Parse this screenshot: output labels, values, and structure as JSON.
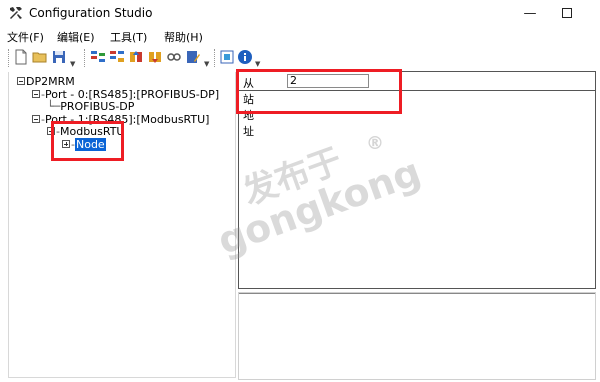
{
  "window": {
    "title": "Configuration Studio",
    "icon": "tools-icon",
    "minimize_glyph": "—"
  },
  "menubar": {
    "items": [
      "文件(F)",
      "编辑(E)",
      "工具(T)",
      "帮助(H)"
    ]
  },
  "toolbar": {
    "buttons": [
      "new-file-icon",
      "open-folder-icon",
      "save-icon",
      "device-config-icon",
      "device-list-icon",
      "upload-icon",
      "download-icon",
      "connect-icon",
      "edit-icon",
      "compile-icon",
      "info-icon"
    ]
  },
  "tree": {
    "root": "DP2MRM",
    "port0": "Port - 0:[RS485]:[PROFIBUS-DP]",
    "port0_child": "PROFIBUS-DP",
    "port1": "Port - 1:[RS485]:[ModbusRTU]",
    "port1_child": "ModbusRTU",
    "node": "Node"
  },
  "properties": {
    "slave_address_label": "从站地址",
    "slave_address_value": "2"
  },
  "watermark": {
    "cn": "发布于",
    "en": "gongkong",
    "reg": "®"
  },
  "colors": {
    "highlight": "#ee1d24",
    "selection": "#0a64d6"
  }
}
